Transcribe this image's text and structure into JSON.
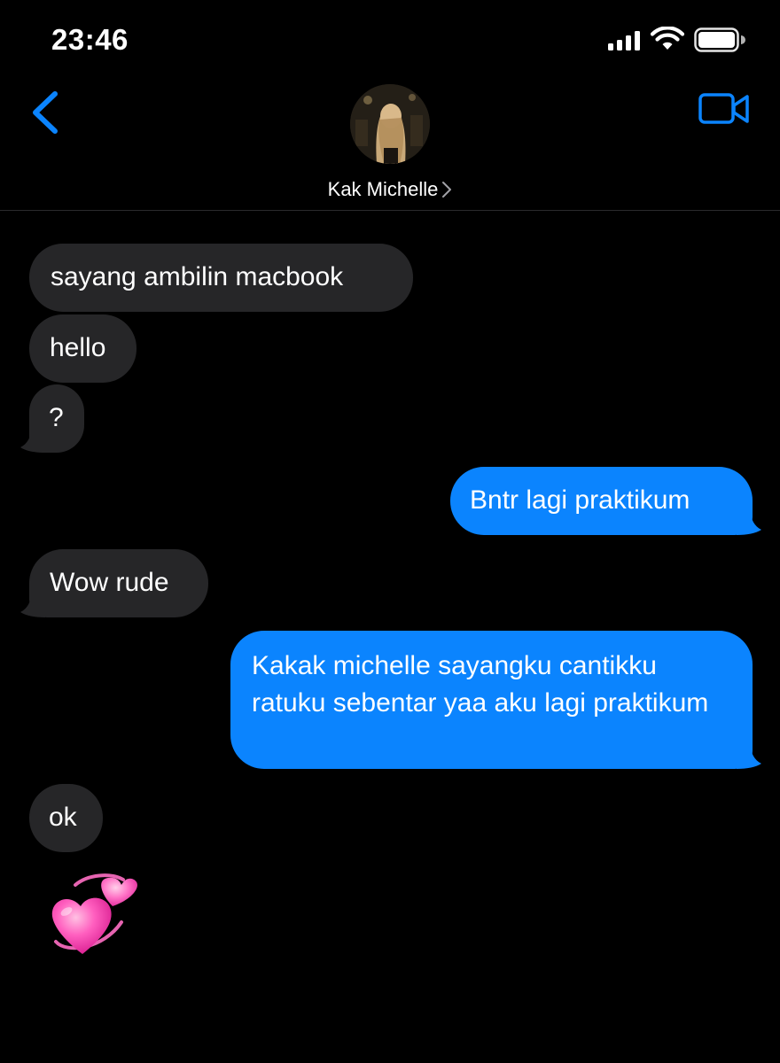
{
  "status_bar": {
    "time": "23:46"
  },
  "header": {
    "contact_name": "Kak Michelle"
  },
  "colors": {
    "accent": "#0b84fe",
    "incoming_bubble": "#262628",
    "background": "#000000"
  },
  "icons": [
    "back-chevron-icon",
    "video-call-icon",
    "signal-icon",
    "wifi-icon",
    "battery-icon",
    "chevron-right-icon",
    "revolving-hearts-emoji"
  ],
  "messages": [
    {
      "direction": "incoming",
      "text": "sayang ambilin macbook"
    },
    {
      "direction": "incoming",
      "text": "hello"
    },
    {
      "direction": "incoming",
      "text": "?"
    },
    {
      "direction": "outgoing",
      "text": "Bntr lagi praktikum"
    },
    {
      "direction": "incoming",
      "text": "Wow rude"
    },
    {
      "direction": "outgoing",
      "text": "Kakak michelle sayangku cantikku ratuku sebentar yaa aku lagi praktikum"
    },
    {
      "direction": "incoming",
      "text": "ok"
    },
    {
      "direction": "incoming",
      "emoji": "revolving-hearts"
    }
  ]
}
